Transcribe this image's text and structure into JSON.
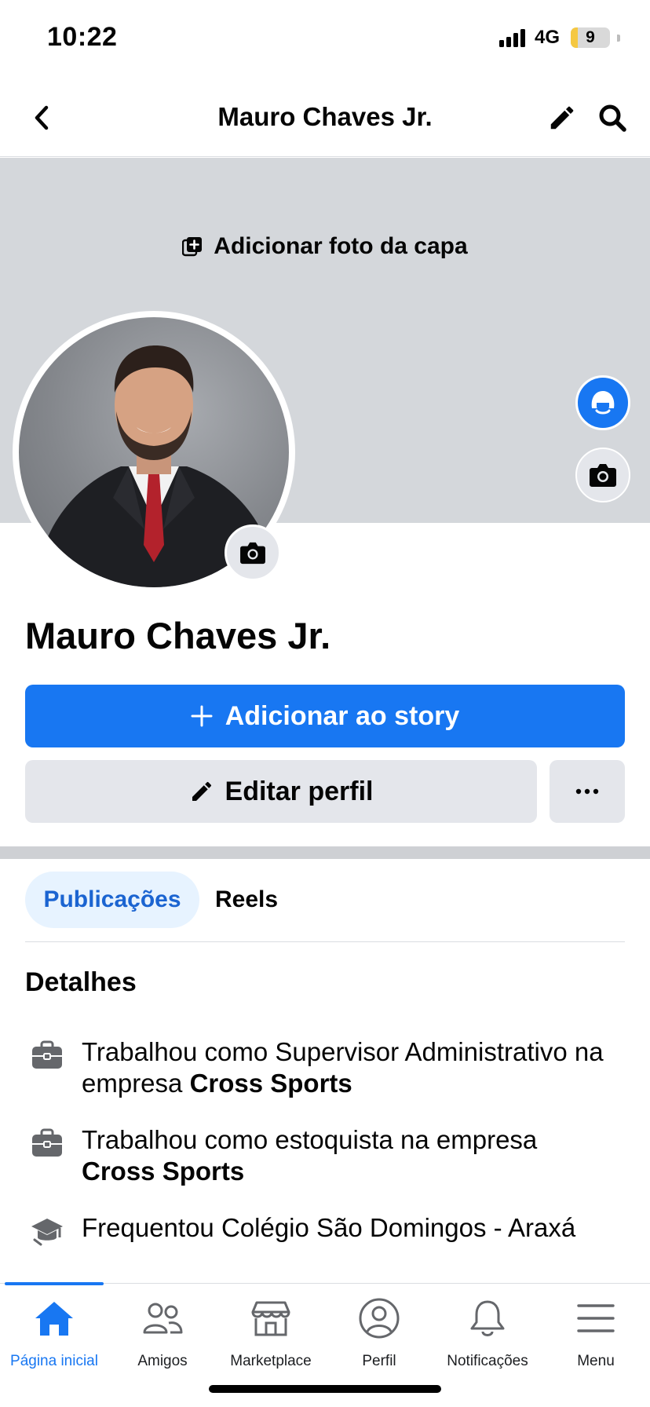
{
  "status_bar": {
    "time": "10:22",
    "network": "4G",
    "battery": "9",
    "battery_fraction": 0.18
  },
  "header": {
    "title": "Mauro Chaves Jr.",
    "back_icon": "chevron-left-icon",
    "edit_icon": "pencil-icon",
    "search_icon": "search-icon"
  },
  "cover": {
    "add_label": "Adicionar foto da capa"
  },
  "profile": {
    "name": "Mauro Chaves Jr."
  },
  "actions": {
    "story_label": "Adicionar ao story",
    "edit_label": "Editar perfil"
  },
  "tabs": [
    {
      "label": "Publicações",
      "active": true
    },
    {
      "label": "Reels",
      "active": false
    }
  ],
  "details": {
    "title": "Detalhes",
    "items": [
      {
        "icon": "briefcase-icon",
        "text": "Trabalhou como Supervisor Administrativo na empresa ",
        "bold": "Cross Sports"
      },
      {
        "icon": "briefcase-icon",
        "text": "Trabalhou como estoquista na empresa ",
        "bold": "Cross Sports"
      },
      {
        "icon": "graduation-cap-icon",
        "text": "Frequentou Colégio São Domingos - Araxá",
        "bold": ""
      }
    ]
  },
  "bottom_nav": [
    {
      "label": "Página inicial",
      "icon": "home-icon",
      "active": true
    },
    {
      "label": "Amigos",
      "icon": "friends-icon",
      "active": false
    },
    {
      "label": "Marketplace",
      "icon": "marketplace-icon",
      "active": false
    },
    {
      "label": "Perfil",
      "icon": "profile-icon",
      "active": false
    },
    {
      "label": "Notificações",
      "icon": "bell-icon",
      "active": false
    },
    {
      "label": "Menu",
      "icon": "menu-icon",
      "active": false
    }
  ],
  "colors": {
    "accent": "#1877f2",
    "tab_active_bg": "#e7f3ff",
    "cover_bg": "#d4d7db",
    "button_gray": "#e4e6eb"
  }
}
